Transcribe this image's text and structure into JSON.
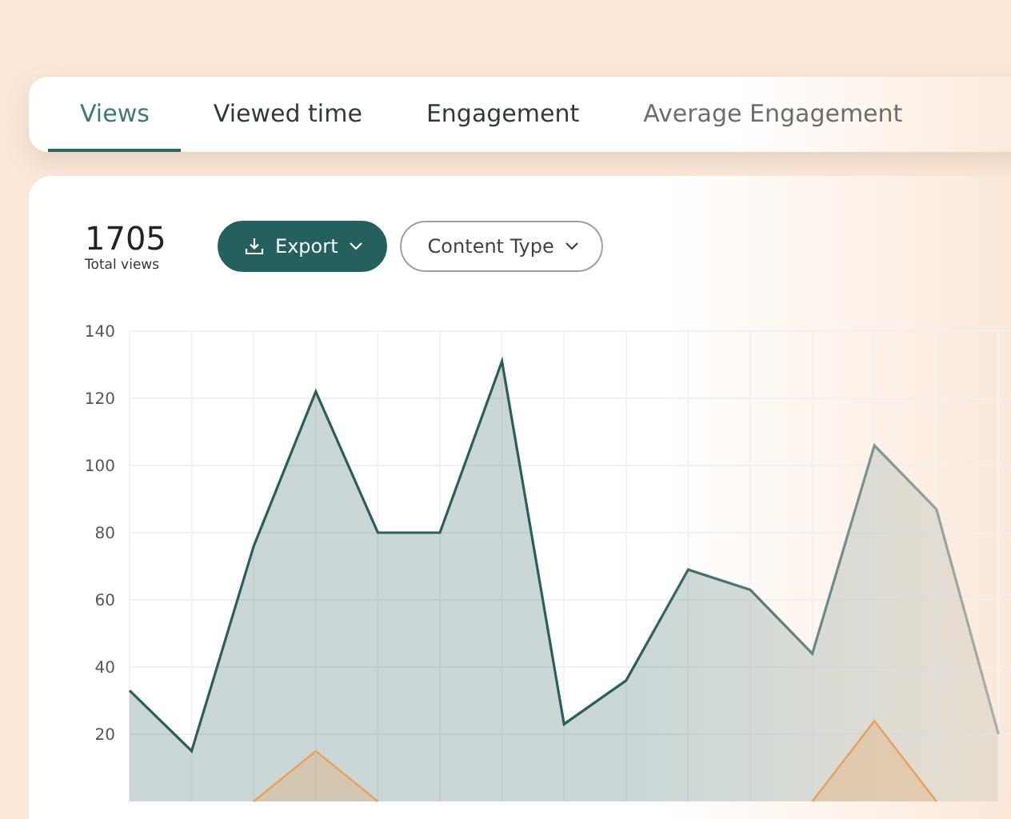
{
  "tabs": [
    {
      "label": "Views",
      "selected": true
    },
    {
      "label": "Viewed time",
      "selected": false
    },
    {
      "label": "Engagement",
      "selected": false
    },
    {
      "label": "Average Engagement",
      "selected": false
    }
  ],
  "summary": {
    "value": "1705",
    "label": "Total views"
  },
  "buttons": [
    {
      "kind": "primary",
      "label": "Export"
    },
    {
      "kind": "outline",
      "label": "Content Type"
    }
  ],
  "chart_data": {
    "type": "area",
    "grid": true,
    "ylim": [
      0,
      140
    ],
    "yticks": [
      20,
      40,
      60,
      80,
      100,
      120,
      140
    ],
    "series": [
      {
        "color": "#2b5f5a",
        "values": [
          33,
          15,
          76,
          122,
          80,
          80,
          131,
          23,
          36,
          69,
          63,
          44,
          106,
          87,
          20
        ]
      },
      {
        "color": "#e8a15c",
        "values": [
          null,
          null,
          0,
          15,
          0,
          null,
          null,
          null,
          null,
          null,
          null,
          0,
          24,
          0,
          null
        ]
      }
    ]
  }
}
